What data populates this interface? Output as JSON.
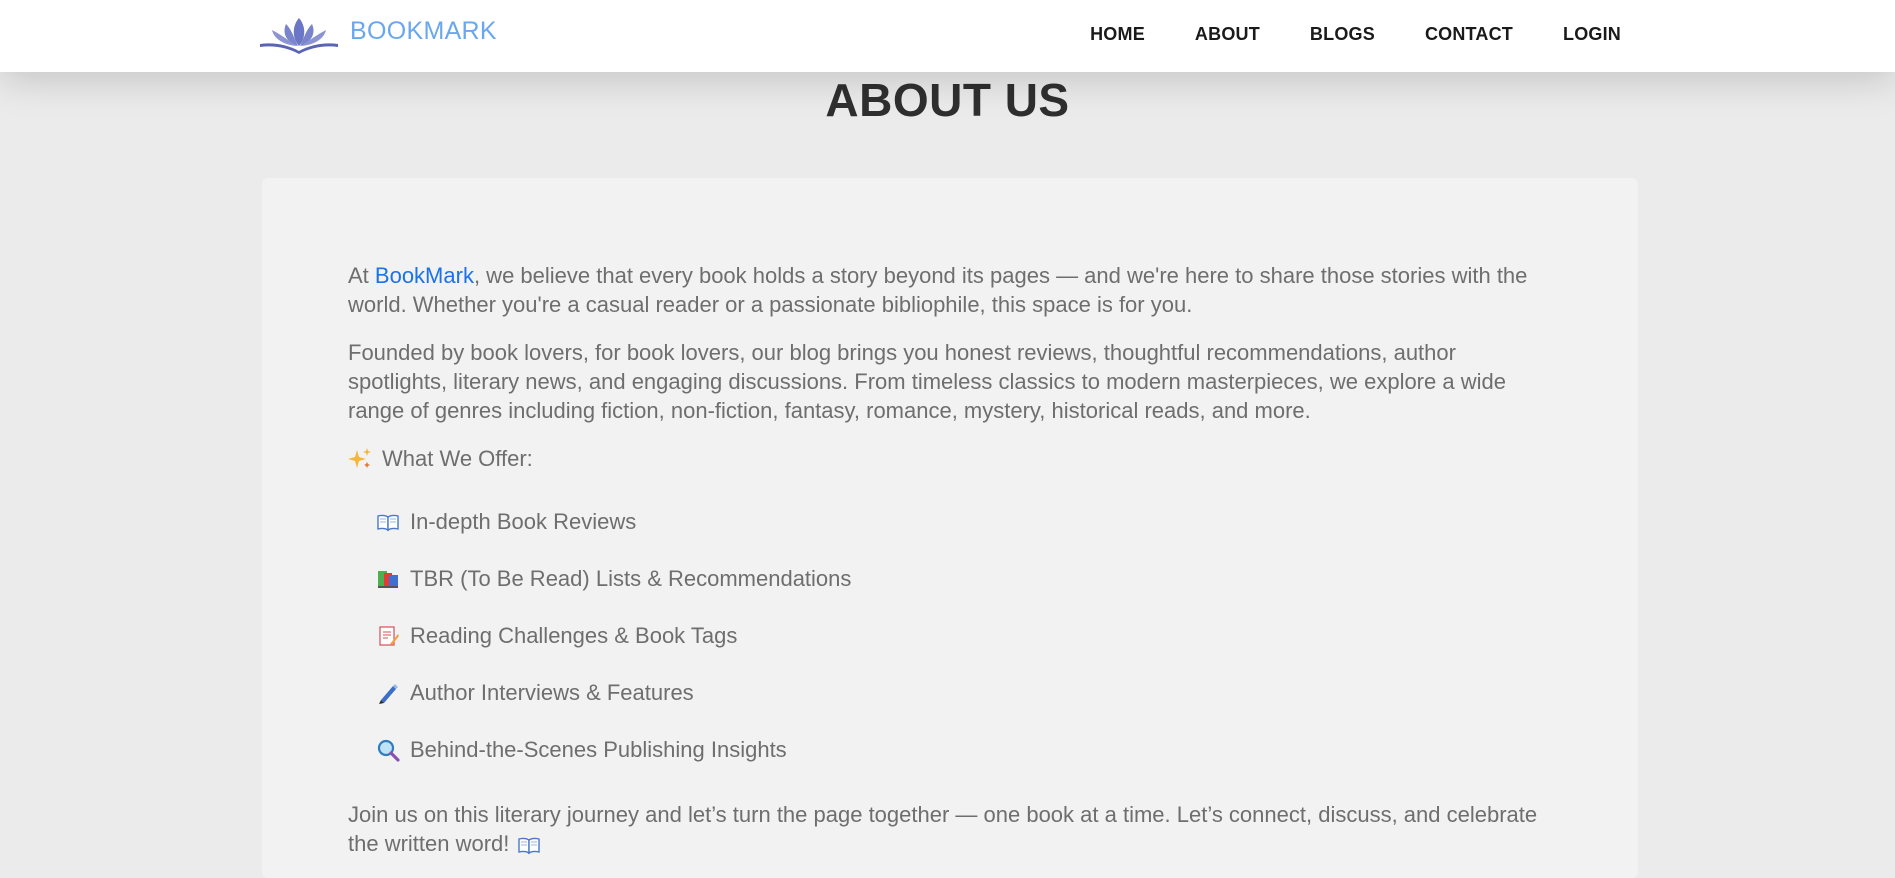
{
  "header": {
    "brand": "BOOKMARK",
    "nav": [
      "HOME",
      "ABOUT",
      "BLOGS",
      "CONTACT",
      "LOGIN"
    ]
  },
  "page": {
    "title": "ABOUT US"
  },
  "about": {
    "intro_prefix": "At ",
    "intro_brand": "BookMark",
    "intro_rest": ", we believe that every book holds a story beyond its pages — and we're here to share those stories with the world. Whether you're a casual reader or a passionate bibliophile, this space is for you.",
    "founded": "Founded by book lovers, for book lovers, our blog brings you honest reviews, thoughtful recommendations, author spotlights, literary news, and engaging discussions. From timeless classics to modern masterpieces, we explore a wide range of genres including fiction, non-fiction, fantasy, romance, mystery, historical reads, and more.",
    "offer_heading": "What We Offer:",
    "offers": [
      {
        "icon": "open-book-icon",
        "label": "In-depth Book Reviews"
      },
      {
        "icon": "books-stack-icon",
        "label": "TBR (To Be Read) Lists & Recommendations"
      },
      {
        "icon": "memo-icon",
        "label": "Reading Challenges & Book Tags"
      },
      {
        "icon": "pen-icon",
        "label": "Author Interviews & Features"
      },
      {
        "icon": "magnifier-icon",
        "label": "Behind-the-Scenes Publishing Insights"
      }
    ],
    "closing": "Join us on this literary journey and let’s turn the page together — one book at a time. Let’s connect, discuss, and celebrate the written word!"
  },
  "colors": {
    "brand": "#69a7ee",
    "link": "#1a73e8",
    "body_text": "#6e6e6e",
    "title": "#2f2f2f",
    "background": "#ebebeb",
    "card": "#f2f2f2"
  }
}
